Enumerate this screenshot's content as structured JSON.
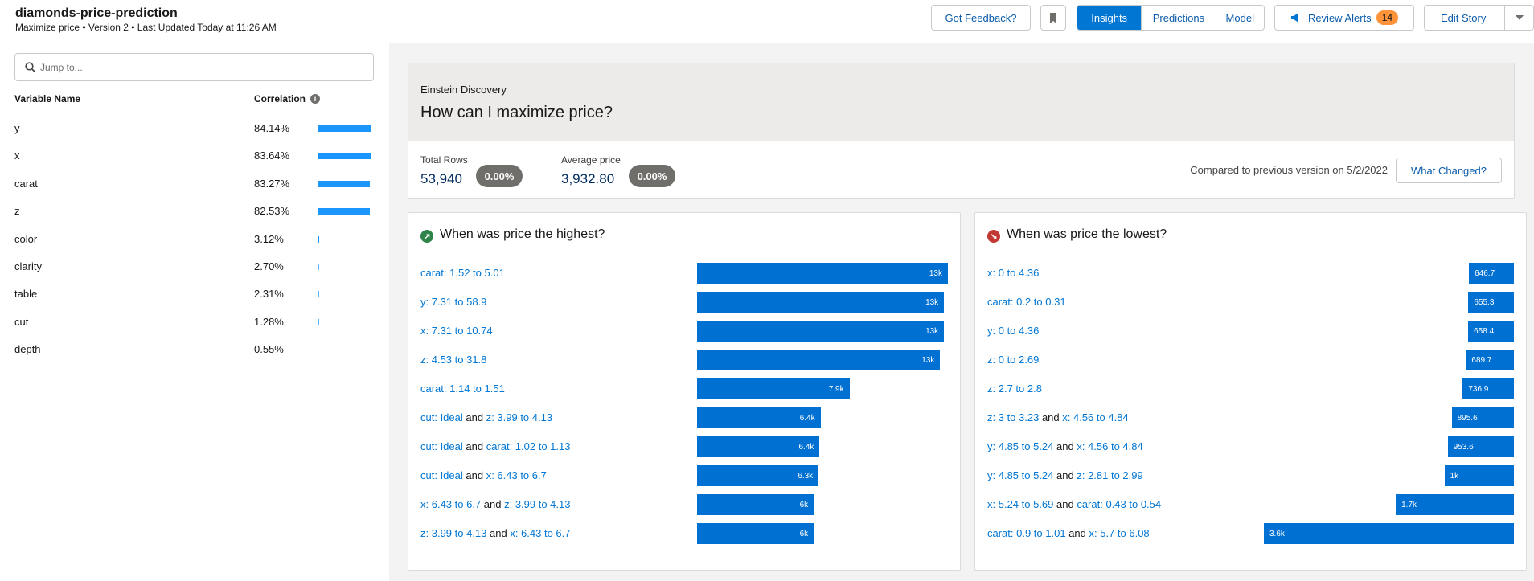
{
  "header": {
    "title": "diamonds-price-prediction",
    "subtitle": "Maximize price • Version 2 • Last Updated Today at 11:26 AM",
    "feedback": "Got Feedback?",
    "tabs": [
      "Insights",
      "Predictions",
      "Model"
    ],
    "review_alerts": "Review Alerts",
    "alerts_count": "14",
    "edit_story": "Edit Story"
  },
  "sidebar": {
    "search_placeholder": "Jump to...",
    "col_variable": "Variable Name",
    "col_correlation": "Correlation",
    "variables": [
      {
        "name": "y",
        "corr": "84.14%",
        "value": 84.14
      },
      {
        "name": "x",
        "corr": "83.64%",
        "value": 83.64
      },
      {
        "name": "carat",
        "corr": "83.27%",
        "value": 83.27
      },
      {
        "name": "z",
        "corr": "82.53%",
        "value": 82.53
      },
      {
        "name": "color",
        "corr": "3.12%",
        "value": 3.12
      },
      {
        "name": "clarity",
        "corr": "2.70%",
        "value": 2.7
      },
      {
        "name": "table",
        "corr": "2.31%",
        "value": 2.31
      },
      {
        "name": "cut",
        "corr": "1.28%",
        "value": 1.28
      },
      {
        "name": "depth",
        "corr": "0.55%",
        "value": 0.55
      }
    ]
  },
  "summary": {
    "label": "Einstein Discovery",
    "question": "How can I maximize price?",
    "total_rows_label": "Total Rows",
    "total_rows": "53,940",
    "total_rows_change": "0.00%",
    "avg_label": "Average price",
    "avg_value": "3,932.80",
    "avg_change": "0.00%",
    "compared": "Compared to previous version on 5/2/2022",
    "what_changed": "What Changed?"
  },
  "highest": {
    "title": "When was price the highest?",
    "rows": [
      {
        "parts": [
          [
            "carat: 1.52 to 5.01",
            true
          ]
        ],
        "label": "13k",
        "value": 13000
      },
      {
        "parts": [
          [
            "y: 7.31 to 58.9",
            true
          ]
        ],
        "label": "13k",
        "value": 12800
      },
      {
        "parts": [
          [
            "x: 7.31 to 10.74",
            true
          ]
        ],
        "label": "13k",
        "value": 12800
      },
      {
        "parts": [
          [
            "z: 4.53 to 31.8",
            true
          ]
        ],
        "label": "13k",
        "value": 12600
      },
      {
        "parts": [
          [
            "carat: 1.14 to 1.51",
            true
          ]
        ],
        "label": "7.9k",
        "value": 7900
      },
      {
        "parts": [
          [
            "cut: Ideal",
            true
          ],
          [
            " and ",
            false
          ],
          [
            "z: 3.99 to 4.13",
            true
          ]
        ],
        "label": "6.4k",
        "value": 6400
      },
      {
        "parts": [
          [
            "cut: Ideal",
            true
          ],
          [
            " and ",
            false
          ],
          [
            "carat: 1.02 to 1.13",
            true
          ]
        ],
        "label": "6.4k",
        "value": 6350
      },
      {
        "parts": [
          [
            "cut: Ideal",
            true
          ],
          [
            " and ",
            false
          ],
          [
            "x: 6.43 to 6.7",
            true
          ]
        ],
        "label": "6.3k",
        "value": 6300
      },
      {
        "parts": [
          [
            "x: 6.43 to 6.7",
            true
          ],
          [
            " and ",
            false
          ],
          [
            "z: 3.99 to 4.13",
            true
          ]
        ],
        "label": "6k",
        "value": 6050
      },
      {
        "parts": [
          [
            "z: 3.99 to 4.13",
            true
          ],
          [
            " and ",
            false
          ],
          [
            "x: 6.43 to 6.7",
            true
          ]
        ],
        "label": "6k",
        "value": 6050
      }
    ]
  },
  "lowest": {
    "title": "When was price the lowest?",
    "rows": [
      {
        "parts": [
          [
            "x: 0 to 4.36",
            true
          ]
        ],
        "label": "646.7",
        "value": 646.7
      },
      {
        "parts": [
          [
            "carat: 0.2 to 0.31",
            true
          ]
        ],
        "label": "655.3",
        "value": 655.3
      },
      {
        "parts": [
          [
            "y: 0 to 4.36",
            true
          ]
        ],
        "label": "658.4",
        "value": 658.4
      },
      {
        "parts": [
          [
            "z: 0 to 2.69",
            true
          ]
        ],
        "label": "689.7",
        "value": 689.7
      },
      {
        "parts": [
          [
            "z: 2.7 to 2.8",
            true
          ]
        ],
        "label": "736.9",
        "value": 736.9
      },
      {
        "parts": [
          [
            "z: 3 to 3.23",
            true
          ],
          [
            " and ",
            false
          ],
          [
            "x: 4.56 to 4.84",
            true
          ]
        ],
        "label": "895.6",
        "value": 895.6
      },
      {
        "parts": [
          [
            "y: 4.85 to 5.24",
            true
          ],
          [
            " and ",
            false
          ],
          [
            "x: 4.56 to 4.84",
            true
          ]
        ],
        "label": "953.6",
        "value": 953.6
      },
      {
        "parts": [
          [
            "y: 4.85 to 5.24",
            true
          ],
          [
            " and ",
            false
          ],
          [
            "z: 2.81 to 2.99",
            true
          ]
        ],
        "label": "1k",
        "value": 1000
      },
      {
        "parts": [
          [
            "x: 5.24 to 5.69",
            true
          ],
          [
            " and ",
            false
          ],
          [
            "carat: 0.43 to 0.54",
            true
          ]
        ],
        "label": "1.7k",
        "value": 1700
      },
      {
        "parts": [
          [
            "carat: 0.9 to 1.01",
            true
          ],
          [
            " and ",
            false
          ],
          [
            "x: 5.7 to 6.08",
            true
          ]
        ],
        "label": "3.6k",
        "value": 3600
      }
    ]
  }
}
